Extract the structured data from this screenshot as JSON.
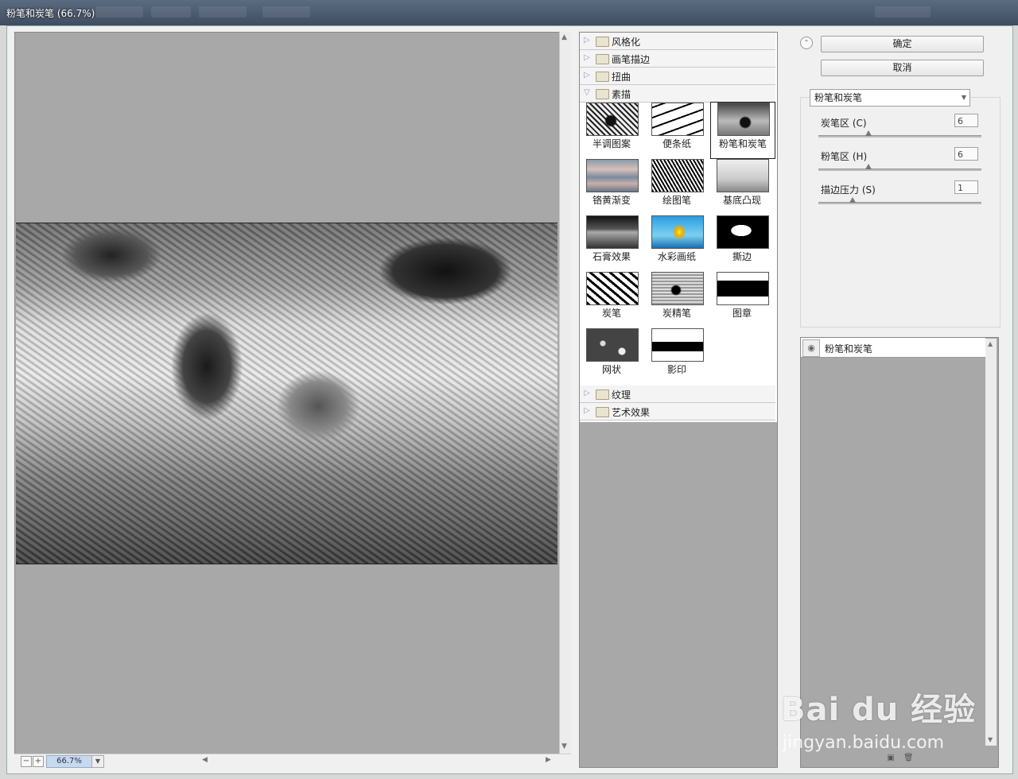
{
  "window": {
    "title": "粉笔和炭笔 (66.7%)"
  },
  "preview": {
    "zoom": "66.7%"
  },
  "gallery": {
    "categories_top": [
      {
        "label": "风格化",
        "expanded": false
      },
      {
        "label": "画笔描边",
        "expanded": false
      },
      {
        "label": "扭曲",
        "expanded": false
      },
      {
        "label": "素描",
        "expanded": true
      }
    ],
    "filters": [
      {
        "label": "半调图案"
      },
      {
        "label": "便条纸"
      },
      {
        "label": "粉笔和炭笔",
        "selected": true
      },
      {
        "label": "铬黄渐变"
      },
      {
        "label": "绘图笔"
      },
      {
        "label": "基底凸现"
      },
      {
        "label": "石膏效果"
      },
      {
        "label": "水彩画纸"
      },
      {
        "label": "撕边"
      },
      {
        "label": "炭笔"
      },
      {
        "label": "炭精笔"
      },
      {
        "label": "图章"
      },
      {
        "label": "网状"
      },
      {
        "label": "影印"
      }
    ],
    "categories_bottom": [
      {
        "label": "纹理",
        "expanded": false
      },
      {
        "label": "艺术效果",
        "expanded": false
      }
    ]
  },
  "buttons": {
    "ok": "确定",
    "cancel": "取消"
  },
  "settings": {
    "filter_select": "粉笔和炭笔",
    "params": [
      {
        "label": "炭笔区 (C)",
        "value": "6",
        "level": 0.3
      },
      {
        "label": "粉笔区 (H)",
        "value": "6",
        "level": 0.3
      },
      {
        "label": "描边压力 (S)",
        "value": "1",
        "level": 0.2
      }
    ]
  },
  "layers": [
    {
      "name": "粉笔和炭笔",
      "visible": true
    }
  ],
  "watermark": {
    "brand": "Bai du 经验",
    "url": "jingyan.baidu.com"
  }
}
